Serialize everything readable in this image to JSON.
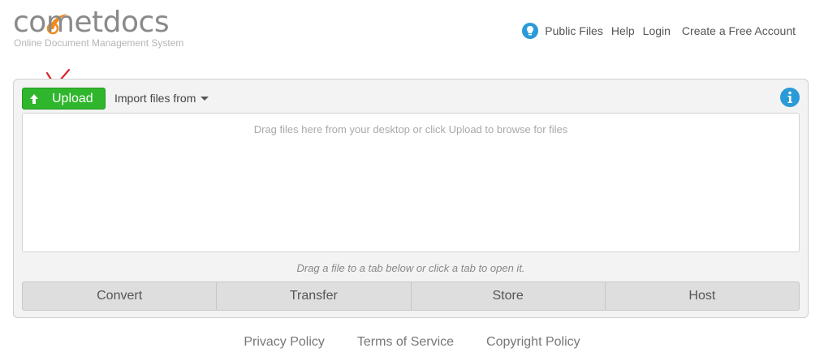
{
  "brand": {
    "logo_text": "cometdocs",
    "tagline": "Online Document Management System",
    "accent": "#f08a1c"
  },
  "header": {
    "nav": [
      {
        "label": "Public Files",
        "icon": "lightbulb-icon"
      },
      {
        "label": "Help"
      },
      {
        "label": "Login"
      },
      {
        "label": "Create a Free Account"
      }
    ]
  },
  "panel": {
    "upload_label": "Upload",
    "upload_icon": "upload-arrow-icon",
    "upload_color": "#2fb62c",
    "import_label": "Import files from",
    "info_icon": "info-icon",
    "dropzone_hint": "Drag files here from your desktop or click Upload to browse for files",
    "tab_hint": "Drag a file to a tab below or click a tab to open it.",
    "tabs": [
      {
        "label": "Convert"
      },
      {
        "label": "Transfer"
      },
      {
        "label": "Store"
      },
      {
        "label": "Host"
      }
    ]
  },
  "footer": {
    "links": [
      {
        "label": "Privacy Policy"
      },
      {
        "label": "Terms of Service"
      },
      {
        "label": "Copyright Policy"
      }
    ]
  }
}
